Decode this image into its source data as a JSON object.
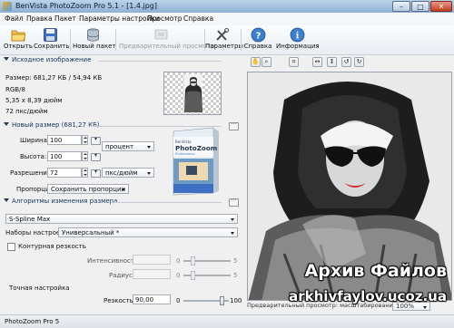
{
  "window": {
    "title": "BenVista PhotoZoom Pro 5.1 - [1.4.jpg]",
    "min": "–",
    "max": "□",
    "close": "✕"
  },
  "menu": [
    "Файл",
    "Правка",
    "Пакет",
    "Параметры настройки",
    "Просмотр",
    "Справка"
  ],
  "toolbar": {
    "open": "Открыть",
    "save": "Сохранить",
    "batch": "Новый пакет",
    "preview": "Предварительный просмотр",
    "settings": "Параметры",
    "help": "Справка",
    "info": "Информация"
  },
  "source": {
    "header": "Исходное изображение",
    "size": "Размер: 681,27 КБ / 54,94 КБ",
    "color": "RGB/8",
    "dims": "5,35 x 8,39 дюйм",
    "dpi": "72 пкс/дюйм"
  },
  "newsize": {
    "header": "Новый размер (681,27 КБ)",
    "width_label": "Ширина:",
    "width_value": "100",
    "height_label": "Высота:",
    "height_value": "100",
    "res_label": "Разрешение:",
    "res_value": "72",
    "unit": "процент",
    "res_unit": "пкс/дюйм",
    "prop_label": "Пропорции:",
    "prop_value": "Сохранить пропорции"
  },
  "product": {
    "brand": "BenVista",
    "name": "PhotoZoom",
    "edition": "Professional"
  },
  "algorithm": {
    "header": "Алгоритмы изменения размера",
    "method": "S-Spline Max",
    "presets_label": "Наборы настроек:",
    "presets_value": "Универсальный *",
    "sharpness_label": "Контурная резкость",
    "intensity_label": "Интенсивность:",
    "intensity_value": "",
    "intensity_min": "0",
    "intensity_max": "5",
    "radius_label": "Радиус:",
    "radius_value": "",
    "radius_min": "0",
    "radius_max": "5",
    "fine_label": "Точная настройка",
    "crisp_label": "Резкость:",
    "crisp_value": "90,00",
    "crisp_min": "0",
    "crisp_max": "100"
  },
  "preview": {
    "status": "Предварительный просмотр: масштабирование:",
    "zoom": "100%"
  },
  "statusbar": {
    "text": "PhotoZoom Pro 5"
  },
  "watermark": {
    "line1": "Архив Файлов",
    "line2": "arkhivfaylov.ucoz.ua"
  },
  "colors": {
    "accent": "#3a7fd0",
    "header_text": "#10315f"
  }
}
